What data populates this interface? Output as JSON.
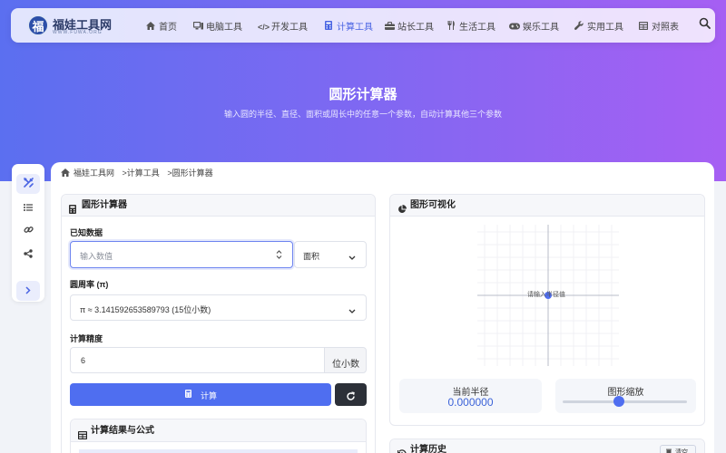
{
  "nav": {
    "logo_char": "福",
    "logo_text": "福娃工具网",
    "logo_domain": "WWW.FUWA.ORG",
    "items": [
      {
        "label": "首页",
        "icon": "home-icon"
      },
      {
        "label": "电脑工具",
        "icon": "desktop-icon"
      },
      {
        "label": "开发工具",
        "icon": "code-icon"
      },
      {
        "label": "计算工具",
        "icon": "calculator-icon",
        "active": true
      },
      {
        "label": "站长工具",
        "icon": "toolbox-icon"
      },
      {
        "label": "生活工具",
        "icon": "utensils-icon"
      },
      {
        "label": "娱乐工具",
        "icon": "gamepad-icon"
      },
      {
        "label": "实用工具",
        "icon": "wrench-icon"
      },
      {
        "label": "对照表",
        "icon": "table-icon"
      }
    ]
  },
  "hero": {
    "title": "圆形计算器",
    "subtitle": "输入圆的半径、直径、面积或周长中的任意一个参数，自动计算其他三个参数"
  },
  "breadcrumb": [
    "福娃工具网",
    ">计算工具",
    ">圆形计算器"
  ],
  "calculator": {
    "title": "圆形计算器",
    "known_label": "已知数据",
    "input_placeholder": "输入数值",
    "type_selected": "面积",
    "pi_label": "圆周率 (π)",
    "pi_selected": "π ≈ 3.141592653589793 (15位小数)",
    "precision_label": "计算精度",
    "precision_value": "6",
    "precision_unit": "位小数",
    "calc_button": "计算"
  },
  "results": {
    "title": "计算结果与公式"
  },
  "visual": {
    "title": "图形可视化",
    "canvas_hint": "请输入半径值",
    "radius_label": "当前半径",
    "radius_value": "0.000000",
    "zoom_label": "图形缩放",
    "zoom_level": 0.45
  },
  "history": {
    "title": "计算历史",
    "clear_label": "清空"
  },
  "colors": {
    "accent": "#4f6ef0",
    "hero_start": "#5b6ff0",
    "hero_end": "#a65ff3"
  }
}
